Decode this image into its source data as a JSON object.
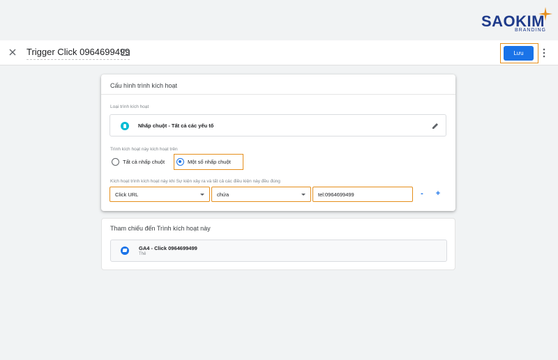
{
  "brand": {
    "name": "SAOKIM",
    "sub": "BRANDING",
    "accent": "#e58e1a",
    "color": "#1e3a8a"
  },
  "header": {
    "title": "Trigger Click 0964699499",
    "save_label": "Lưu"
  },
  "config": {
    "card_title": "Cấu hình trình kích hoạt",
    "type_label": "Loại trình kích hoạt",
    "type_name": "Nhấp chuột - Tất cả các yếu tố",
    "fires_on_label": "Trình kích hoạt này kích hoạt trên",
    "radio_all": "Tất cả nhấp chuột",
    "radio_some": "Một số nhấp chuột",
    "selected_option": "radio_some",
    "condition_label": "Kích hoạt trình kích hoạt này khi Sự kiện xảy ra và tất cả các điều kiện này đều đúng",
    "condition": {
      "variable": "Click URL",
      "operator": "chứa",
      "value": "tel:0964699499"
    }
  },
  "references": {
    "card_title": "Tham chiếu đến Trình kích hoạt này",
    "items": [
      {
        "name": "GA4 - Click 0964699499",
        "type": "Thẻ"
      }
    ]
  },
  "colors": {
    "primary": "#1a73e8",
    "highlight": "#e58e1a",
    "click_icon": "#00bcd4"
  }
}
